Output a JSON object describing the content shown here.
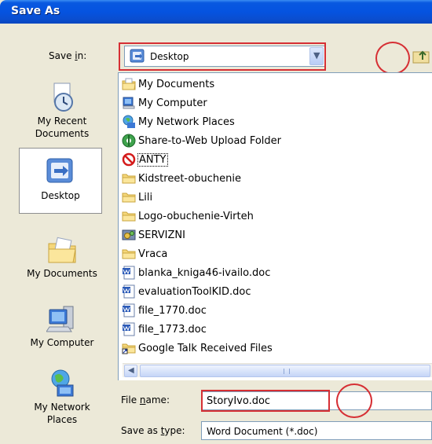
{
  "window": {
    "title": "Save As"
  },
  "save_in": {
    "label_pre": "Save ",
    "label_key": "i",
    "label_post": "n:",
    "value": "Desktop"
  },
  "places": [
    {
      "line1": "My Recent",
      "line2": "Documents",
      "icon": "recent-documents-icon"
    },
    {
      "line1": "Desktop",
      "line2": "",
      "icon": "desktop-icon"
    },
    {
      "line1": "My Documents",
      "line2": "",
      "icon": "my-documents-icon"
    },
    {
      "line1": "My Computer",
      "line2": "",
      "icon": "my-computer-icon"
    },
    {
      "line1": "My Network",
      "line2": "Places",
      "icon": "network-places-icon"
    }
  ],
  "files": [
    {
      "name": "My Documents",
      "icon": "my-documents-icon"
    },
    {
      "name": "My Computer",
      "icon": "my-computer-icon"
    },
    {
      "name": "My Network Places",
      "icon": "network-places-icon"
    },
    {
      "name": "Share-to-Web Upload Folder",
      "icon": "web-folder-icon"
    },
    {
      "name": "ANTY",
      "icon": "forbidden-icon"
    },
    {
      "name": "Kidstreet-obuchenie",
      "icon": "folder-icon"
    },
    {
      "name": "Lili",
      "icon": "folder-icon"
    },
    {
      "name": "Logo-obuchenie-Virteh",
      "icon": "folder-icon"
    },
    {
      "name": "SERVIZNI",
      "icon": "settings-folder-icon"
    },
    {
      "name": "Vraca",
      "icon": "folder-icon"
    },
    {
      "name": "blanka_kniga46-ivailo.doc",
      "icon": "word-doc-icon"
    },
    {
      "name": "evaluationToolKID.doc",
      "icon": "word-doc-icon"
    },
    {
      "name": "file_1770.doc",
      "icon": "word-doc-icon"
    },
    {
      "name": "file_1773.doc",
      "icon": "word-doc-icon"
    },
    {
      "name": "Google Talk Received Files",
      "icon": "shortcut-folder-icon"
    }
  ],
  "file_name": {
    "label_pre": "File ",
    "label_key": "n",
    "label_post": "ame:",
    "value": "StoryIvo.doc"
  },
  "save_as_type": {
    "label_pre": "Save as ",
    "label_key": "t",
    "label_post": "ype:",
    "value": "Word Document (*.doc)"
  },
  "colors": {
    "titlebar": "#0553E0",
    "annotation": "#D62F34",
    "dialog": "#ECE9D8"
  }
}
